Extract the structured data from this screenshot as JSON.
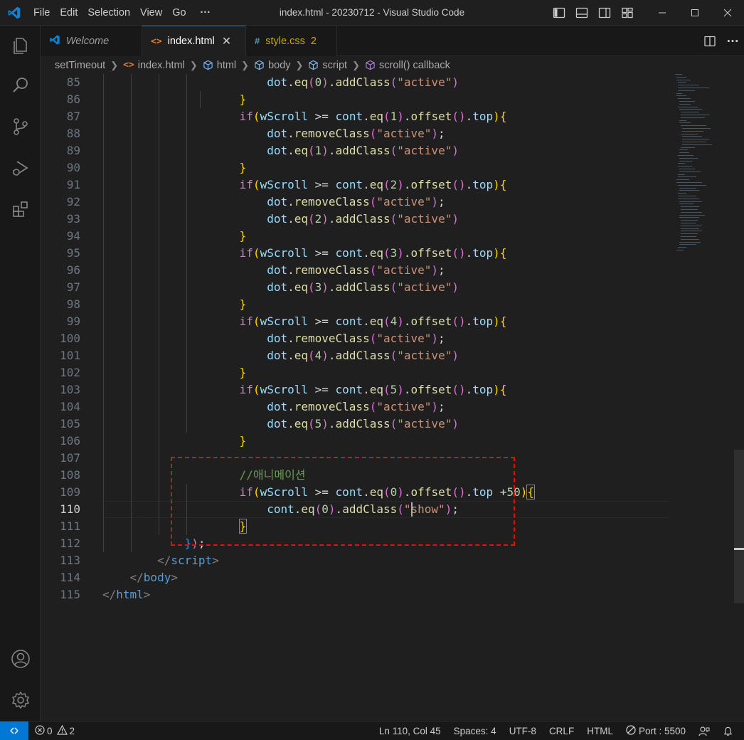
{
  "window": {
    "title": "index.html - 20230712 - Visual Studio Code",
    "menu": [
      "File",
      "Edit",
      "Selection",
      "View",
      "Go",
      "···"
    ]
  },
  "tabs": [
    {
      "label": "Welcome",
      "icon": "vscode-icon"
    },
    {
      "label": "index.html",
      "icon": "html-icon",
      "close": "✕"
    },
    {
      "label": "style.css",
      "icon": "css-icon",
      "badge": "2"
    }
  ],
  "breadcrumb": [
    "setTimeout",
    "index.html",
    "html",
    "body",
    "script",
    "scroll() callback"
  ],
  "editor": {
    "line_numbers": [
      "85",
      "86",
      "87",
      "88",
      "89",
      "90",
      "91",
      "92",
      "93",
      "94",
      "95",
      "96",
      "97",
      "98",
      "99",
      "100",
      "101",
      "102",
      "103",
      "104",
      "105",
      "106",
      "107",
      "108",
      "109",
      "110",
      "111",
      "112",
      "113",
      "114",
      "115"
    ],
    "current_line": "110",
    "comment_text": "//애니메이션"
  },
  "statusbar": {
    "errors": "0",
    "warnings": "2",
    "position": "Ln 110, Col 45",
    "spaces": "Spaces: 4",
    "encoding": "UTF-8",
    "eol": "CRLF",
    "language": "HTML",
    "port": "Port : 5500"
  },
  "colors": {
    "accent": "#0078d4",
    "highlight_box": "#e01010",
    "keyword": "#c586c0",
    "variable": "#9cdcfe",
    "function": "#dcdcaa",
    "string": "#ce9178"
  }
}
